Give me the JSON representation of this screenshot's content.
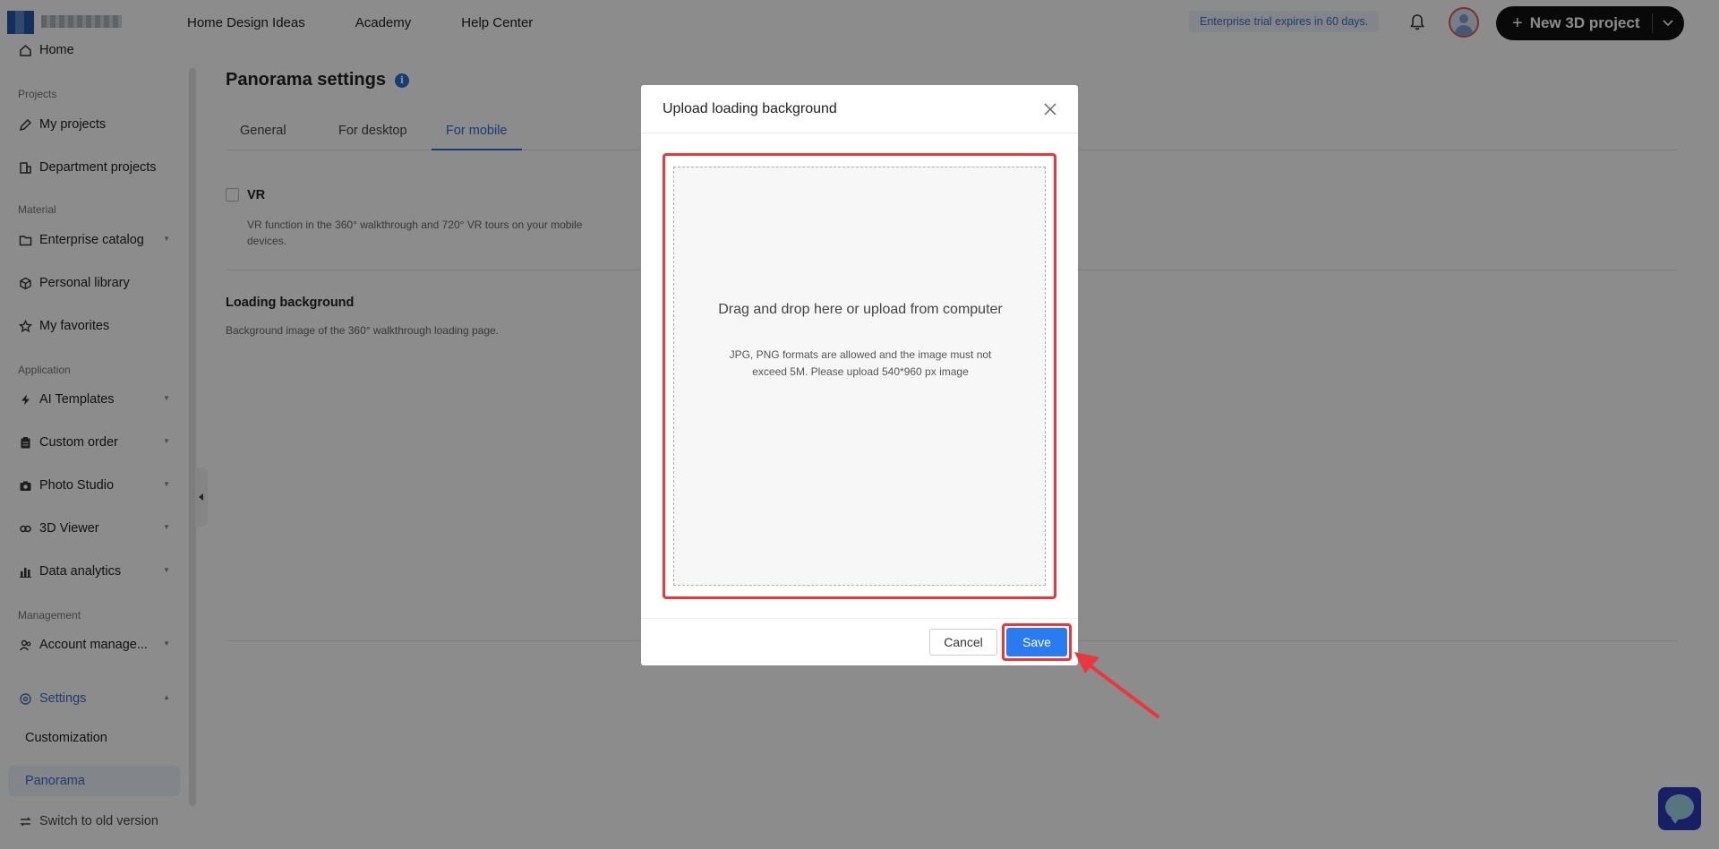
{
  "topbar": {
    "nav": [
      "Home Design Ideas",
      "Academy",
      "Help Center"
    ],
    "trial_notice": "Enterprise trial expires in 60 days.",
    "new_project_label": "New 3D project"
  },
  "sidebar": {
    "home": "Home",
    "sections": {
      "projects": "Projects",
      "material": "Material",
      "application": "Application",
      "management": "Management"
    },
    "items": {
      "my_projects": "My projects",
      "department_projects": "Department projects",
      "enterprise_catalog": "Enterprise catalog",
      "personal_library": "Personal library",
      "my_favorites": "My favorites",
      "ai_templates": "AI Templates",
      "custom_order": "Custom order",
      "photo_studio": "Photo Studio",
      "viewer_3d": "3D Viewer",
      "data_analytics": "Data analytics",
      "account_management": "Account manage...",
      "settings": "Settings"
    },
    "settings_sub": {
      "customization": "Customization",
      "panorama": "Panorama"
    },
    "switch_old": "Switch to old version"
  },
  "main": {
    "title": "Panorama settings",
    "tabs": [
      "General",
      "For desktop",
      "For mobile"
    ],
    "active_tab": "For mobile",
    "vr": {
      "label": "VR",
      "description": "VR function in the 360° walkthrough and 720° VR tours on your mobile devices."
    },
    "loading_background": {
      "title": "Loading background",
      "description": "Background image of the 360° walkthrough loading page."
    }
  },
  "modal": {
    "title": "Upload loading background",
    "dropzone_main": "Drag and drop here or upload from computer",
    "dropzone_hint": "JPG, PNG formats are allowed and the image must not exceed 5M. Please upload 540*960 px image",
    "cancel_label": "Cancel",
    "save_label": "Save"
  },
  "colors": {
    "accent": "#2b7bf0",
    "highlight": "#e8383d",
    "new_project_bg": "#111111"
  }
}
